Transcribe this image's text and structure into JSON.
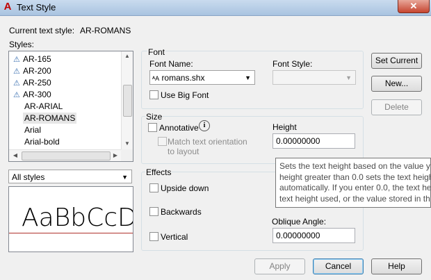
{
  "window": {
    "title": "Text Style",
    "close_glyph": "✕",
    "app_icon": "autocad-logo-icon"
  },
  "current_style": {
    "label": "Current text style:",
    "value": "AR-ROMANS"
  },
  "styles": {
    "label": "Styles:",
    "items": [
      {
        "name": "AR-165",
        "icon": "annotative-icon"
      },
      {
        "name": "AR-200",
        "icon": "annotative-icon"
      },
      {
        "name": "AR-250",
        "icon": "annotative-icon"
      },
      {
        "name": "AR-300",
        "icon": "annotative-icon"
      },
      {
        "name": "AR-ARIAL",
        "icon": ""
      },
      {
        "name": "AR-ROMANS",
        "icon": "",
        "selected": true
      },
      {
        "name": "Arial",
        "icon": ""
      },
      {
        "name": "Arial-bold",
        "icon": ""
      }
    ],
    "filter_value": "All styles",
    "preview_text": "AaBbCcD"
  },
  "font": {
    "group_label": "Font",
    "name_label": "Font Name:",
    "name_value": "romans.shx",
    "style_label": "Font Style:",
    "style_value": "",
    "big_font_label": "Use Big Font",
    "big_font_checked": false
  },
  "size": {
    "group_label": "Size",
    "annotative_label": "Annotative",
    "annotative_checked": false,
    "match_orientation_label": "Match text orientation to layout",
    "match_line1": "Match text orientation",
    "match_line2": "to layout",
    "height_label": "Height",
    "height_value": "0.00000000"
  },
  "effects": {
    "group_label": "Effects",
    "upside_down_label": "Upside down",
    "backwards_label": "Backwards",
    "vertical_label": "Vertical",
    "oblique_label": "Oblique Angle:",
    "oblique_value": "0.00000000"
  },
  "buttons": {
    "set_current": "Set Current",
    "new": "New...",
    "delete": "Delete",
    "apply": "Apply",
    "cancel": "Cancel",
    "help": "Help"
  },
  "tooltip": {
    "lines": [
      "Sets the text height based on the value yo",
      "height greater than 0.0 sets the text heigh",
      "automatically. If you enter 0.0, the text he",
      "text height used, or the value stored in th"
    ]
  },
  "colors": {
    "accent": "#3c7fb1",
    "preview_baseline": "#b0302b",
    "titlebar": "#b9cfe8"
  }
}
